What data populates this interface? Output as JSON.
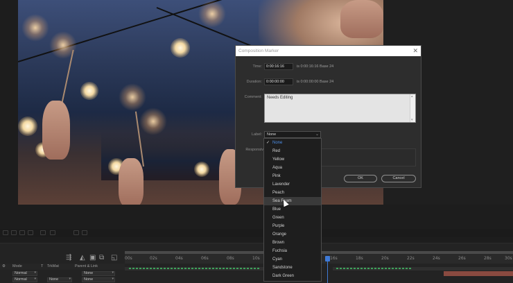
{
  "dialog": {
    "title": "Composition Marker",
    "time_label": "Time:",
    "time_value": "0:00:16:16",
    "time_info": "is 0:00:16:16  Base 24",
    "duration_label": "Duration:",
    "duration_value": "0:00:00:00",
    "duration_info": "is 0:00:00:00  Base 24",
    "comment_label": "Comment:",
    "comment_value": "Needs Editing",
    "label_label": "Label:",
    "label_value": "None",
    "responsive_label": "Responsiv",
    "ok_label": "OK",
    "cancel_label": "Cancel"
  },
  "label_options": [
    "None",
    "Red",
    "Yellow",
    "Aqua",
    "Pink",
    "Lavender",
    "Peach",
    "Sea Foam",
    "Blue",
    "Green",
    "Purple",
    "Orange",
    "Brown",
    "Fuchsia",
    "Cyan",
    "Sandstone",
    "Dark Green"
  ],
  "label_selected": "None",
  "label_hovered": "Sea Foam",
  "timeline": {
    "ruler_ticks": [
      "00s",
      "02s",
      "04s",
      "06s",
      "08s",
      "10s",
      "16s",
      "18s",
      "20s",
      "22s",
      "24s",
      "26s",
      "28s",
      "30s"
    ],
    "headers": {
      "mode": "Mode",
      "t": "T",
      "trkmat": "TrkMat",
      "parent": "Parent & Link"
    },
    "rows": [
      {
        "mode": "Normal",
        "trkmat": "",
        "parent": "None"
      },
      {
        "mode": "Normal",
        "trkmat": "None",
        "parent": "None"
      }
    ]
  },
  "colors": {
    "accent": "#3f7ad6",
    "selected_label": "#4d8fe8",
    "dialog_bg": "#2d2d2d",
    "timeline_bg": "#232323"
  }
}
